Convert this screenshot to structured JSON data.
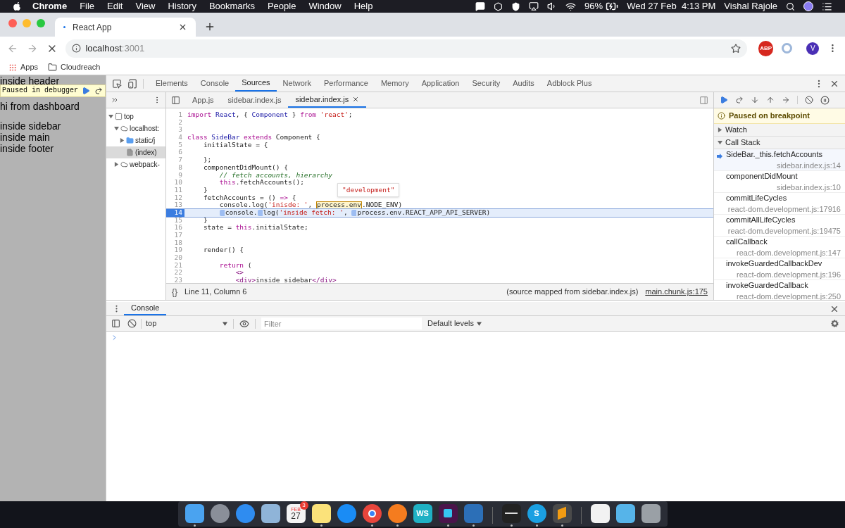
{
  "menubar": {
    "app": "Chrome",
    "menus": [
      "File",
      "Edit",
      "View",
      "History",
      "Bookmarks",
      "People",
      "Window",
      "Help"
    ],
    "battery": "96%",
    "clock": "Wed 27 Feb  4:13 PM",
    "user": "Vishal Rajole"
  },
  "browser": {
    "tab_title": "React App",
    "url_host": "localhost",
    "url_port": ":3001",
    "extension_badge": "ABP",
    "avatar": "V",
    "bookmarks": [
      {
        "kind": "apps",
        "label": "Apps"
      },
      {
        "kind": "folder",
        "label": "Cloudreach"
      }
    ]
  },
  "page": {
    "header_text": "inside header",
    "paused_label": "Paused in debugger",
    "lines": [
      "hi from dashboard",
      "inside sidebar",
      "inside main",
      "inside footer"
    ]
  },
  "devtools": {
    "tabs": [
      {
        "label": "Elements",
        "selected": false
      },
      {
        "label": "Console",
        "selected": false
      },
      {
        "label": "Sources",
        "selected": true
      },
      {
        "label": "Network",
        "selected": false
      },
      {
        "label": "Performance",
        "selected": false
      },
      {
        "label": "Memory",
        "selected": false
      },
      {
        "label": "Application",
        "selected": false
      },
      {
        "label": "Security",
        "selected": false
      },
      {
        "label": "Audits",
        "selected": false
      },
      {
        "label": "Adblock Plus",
        "selected": false
      }
    ],
    "navigator": [
      {
        "label": "top",
        "kind": "frame",
        "expanded": true,
        "selected": false,
        "children": [
          {
            "label": "localhost:",
            "kind": "origin",
            "expanded": true,
            "selected": false,
            "children": [
              {
                "label": "static/j",
                "kind": "folder",
                "expanded": false,
                "selected": false
              },
              {
                "label": "(index)",
                "kind": "file",
                "selected": true
              }
            ]
          },
          {
            "label": "webpack-",
            "kind": "origin",
            "expanded": false,
            "selected": false
          }
        ]
      }
    ],
    "editor_tabs": [
      {
        "label": "App.js",
        "selected": false,
        "closable": false
      },
      {
        "label": "sidebar.index.js",
        "selected": false,
        "closable": false
      },
      {
        "label": "sidebar.index.js",
        "selected": true,
        "closable": true
      }
    ],
    "code": {
      "tooltip": "\"development\"",
      "lines": [
        {
          "number": "1",
          "current": false,
          "tokens": [
            {
              "text": "import ",
              "kind": "kw"
            },
            {
              "text": "React",
              "kind": "var"
            },
            {
              "text": ", { "
            },
            {
              "text": "Component",
              "kind": "var"
            },
            {
              "text": " } "
            },
            {
              "text": "from ",
              "kind": "kw"
            },
            {
              "text": "'react'",
              "kind": "str"
            },
            {
              "text": ";"
            }
          ]
        },
        {
          "number": "2",
          "current": false
        },
        {
          "number": "3",
          "current": false
        },
        {
          "number": "4",
          "current": false,
          "tokens": [
            {
              "text": "class ",
              "kind": "kw"
            },
            {
              "text": "SideBar ",
              "kind": "var"
            },
            {
              "text": "extends ",
              "kind": "kw"
            },
            {
              "text": "Component {"
            }
          ]
        },
        {
          "number": "5",
          "current": false,
          "tokens": [
            {
              "text": "    initialState = {"
            }
          ]
        },
        {
          "number": "6",
          "current": false
        },
        {
          "number": "7",
          "current": false,
          "tokens": [
            {
              "text": "    };"
            }
          ]
        },
        {
          "number": "8",
          "current": false,
          "tokens": [
            {
              "text": "    componentDidMount() {"
            }
          ]
        },
        {
          "number": "9",
          "current": false,
          "tokens": [
            {
              "text": "        // fetch accounts, hierarchy",
              "kind": "comment"
            }
          ]
        },
        {
          "number": "10",
          "current": false,
          "tokens": [
            {
              "text": "        this",
              "kind": "kw"
            },
            {
              "text": ".fetchAccounts();"
            }
          ]
        },
        {
          "number": "11",
          "current": false,
          "tokens": [
            {
              "text": "    }"
            }
          ]
        },
        {
          "number": "12",
          "current": false,
          "tokens": [
            {
              "text": "    fetchAccounts = () "
            },
            {
              "text": "=>",
              "kind": "kw"
            },
            {
              "text": " {"
            }
          ]
        },
        {
          "number": "13",
          "current": false,
          "tokens": [
            {
              "text": "        console.log("
            },
            {
              "text": "'inisde: '",
              "kind": "str"
            },
            {
              "text": ", "
            },
            {
              "text": "process.env",
              "kind": "hover"
            },
            {
              "text": ".NODE_ENV)"
            }
          ]
        },
        {
          "number": "14",
          "current": true,
          "tokens": [
            {
              "text": "        console.",
              "breakpoint": true
            },
            {
              "text": "log(",
              "breakpoint": true
            },
            {
              "text": "'inside fetch: '",
              "kind": "str"
            },
            {
              "text": ", "
            },
            {
              "text": "process.env.REACT_APP_API_SERVER)",
              "breakpoint": true
            }
          ]
        },
        {
          "number": "15",
          "current": false,
          "tokens": [
            {
              "text": "    }"
            }
          ]
        },
        {
          "number": "16",
          "current": false,
          "tokens": [
            {
              "text": "    state = "
            },
            {
              "text": "this",
              "kind": "kw"
            },
            {
              "text": ".initialState;"
            }
          ]
        },
        {
          "number": "17",
          "current": false
        },
        {
          "number": "18",
          "current": false
        },
        {
          "number": "19",
          "current": false,
          "tokens": [
            {
              "text": "    render() {"
            }
          ]
        },
        {
          "number": "20",
          "current": false
        },
        {
          "number": "21",
          "current": false,
          "tokens": [
            {
              "text": "        return",
              "kind": "kw"
            },
            {
              "text": " ("
            }
          ]
        },
        {
          "number": "22",
          "current": false,
          "tokens": [
            {
              "text": "            <>",
              "kind": "tag"
            }
          ]
        },
        {
          "number": "23",
          "current": false,
          "tokens": [
            {
              "text": "            <div>",
              "kind": "tag"
            },
            {
              "text": "inside sidebar"
            },
            {
              "text": "</div>",
              "kind": "tag"
            }
          ]
        }
      ]
    },
    "status": {
      "pretty_print": "{}",
      "position": "Line 11, Column 6",
      "source_map": "(source mapped from sidebar.index.js)",
      "link": "main.chunk.js:175"
    },
    "debugger": {
      "banner": "Paused on breakpoint",
      "sections": [
        {
          "label": "Watch",
          "expanded": false
        },
        {
          "label": "Call Stack",
          "expanded": true
        }
      ],
      "frames": [
        {
          "name": "SideBar._this.fetchAccounts",
          "location": "sidebar.index.js:14",
          "selected": true
        },
        {
          "name": "componentDidMount",
          "location": "sidebar.index.js:10",
          "selected": false
        },
        {
          "name": "commitLifeCycles",
          "location": "react-dom.development.js:17916",
          "selected": false
        },
        {
          "name": "commitAllLifeCycles",
          "location": "react-dom.development.js:19475",
          "selected": false
        },
        {
          "name": "callCallback",
          "location": "react-dom.development.js:147",
          "selected": false
        },
        {
          "name": "invokeGuardedCallbackDev",
          "location": "react-dom.development.js:196",
          "selected": false
        },
        {
          "name": "invokeGuardedCallback",
          "location": "react-dom.development.js:250",
          "selected": false
        }
      ]
    },
    "drawer": {
      "tabs": [
        {
          "label": "Console",
          "selected": true
        }
      ],
      "context": "top",
      "filter_placeholder": "Filter",
      "levels": "Default levels"
    }
  },
  "dock": [
    {
      "kind": "finder",
      "running": true
    },
    {
      "kind": "launchpad",
      "running": false
    },
    {
      "kind": "safari",
      "running": false
    },
    {
      "kind": "preview",
      "running": false
    },
    {
      "kind": "calendar",
      "running": false,
      "month": "FEB",
      "day": "27",
      "badge": "3"
    },
    {
      "kind": "notes",
      "running": true
    },
    {
      "kind": "appstore",
      "running": false
    },
    {
      "kind": "chrome",
      "running": true
    },
    {
      "kind": "firefox",
      "running": true
    },
    {
      "kind": "webstorm",
      "running": false,
      "label": "WS"
    },
    {
      "kind": "slack",
      "running": true
    },
    {
      "kind": "vscode",
      "running": true
    },
    {
      "kind": "separator"
    },
    {
      "kind": "terminal",
      "running": true
    },
    {
      "kind": "skype",
      "running": true,
      "label": "S"
    },
    {
      "kind": "sublime",
      "running": true
    },
    {
      "kind": "separator"
    },
    {
      "kind": "document",
      "running": false
    },
    {
      "kind": "downloads",
      "running": false
    },
    {
      "kind": "trash",
      "running": false
    }
  ]
}
